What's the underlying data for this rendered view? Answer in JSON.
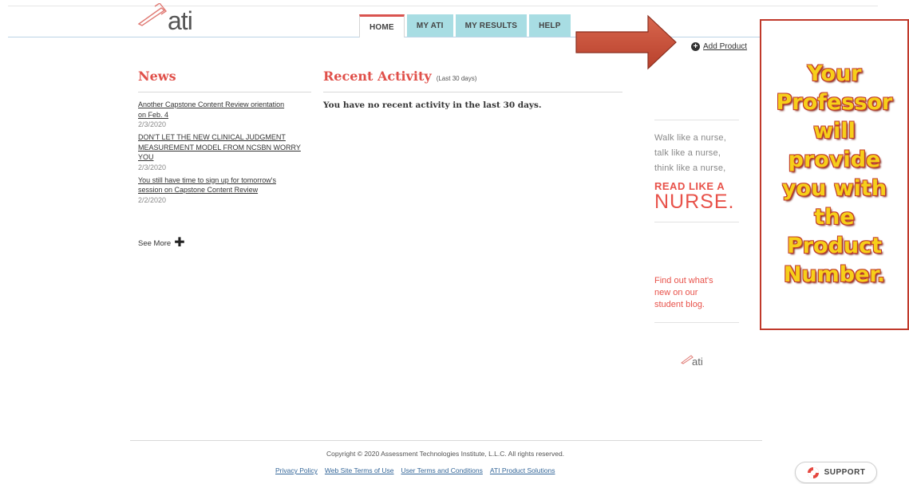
{
  "header": {
    "logo_text": "ati",
    "tabs": [
      {
        "label": "HOME",
        "active": true
      },
      {
        "label": "MY ATI",
        "active": false
      },
      {
        "label": "MY RESULTS",
        "active": false
      },
      {
        "label": "HELP",
        "active": false
      }
    ],
    "add_product_label": "Add Product"
  },
  "callout": {
    "text": "Your Professor will provide you with the Product Number.",
    "lines": [
      "Your",
      "Professor",
      "will",
      "provide",
      "you with",
      "the",
      "Product",
      "Number."
    ],
    "text_color": "#f6cf1a",
    "border_color": "#c0392b",
    "arrow_color": "#c9523c"
  },
  "news": {
    "title": "News",
    "items": [
      {
        "link": "Another Capstone Content Review orientation on Feb. 4",
        "link_lines": [
          "Another Capstone Content Review orientation",
          "on Feb. 4"
        ],
        "date": "2/3/2020"
      },
      {
        "link": "DON'T LET THE NEW CLINICAL JUDGMENT MEASUREMENT MODEL FROM NCSBN WORRY YOU",
        "link_lines": [
          "DON'T LET THE NEW CLINICAL JUDGMENT",
          "MEASUREMENT MODEL FROM NCSBN WORRY",
          "YOU"
        ],
        "date": "2/3/2020"
      },
      {
        "link": "You still have time to sign up for tomorrow's session on Capstone Content Review",
        "link_lines": [
          "You still have time to sign up for tomorrow's",
          "session on Capstone Content Review"
        ],
        "date": "2/2/2020"
      }
    ],
    "see_more_label": "See More"
  },
  "recent_activity": {
    "title": "Recent Activity",
    "subtitle": "(Last 30 days)",
    "message": "You have no recent activity in the last 30 days."
  },
  "sidebar": {
    "walk_lines": [
      "Walk like a nurse,",
      "talk like a nurse,",
      "think like a nurse,"
    ],
    "read_like_a": "READ LIKE A",
    "nurse": "NURSE.",
    "blog_lines": [
      "Find out what's",
      "new on our",
      "student blog."
    ],
    "small_logo_text": "ati"
  },
  "footer": {
    "copyright": "Copyright © 2020 Assessment Technologies Institute, L.L.C. All rights reserved.",
    "links": [
      "Privacy Policy",
      "Web Site Terms of Use",
      "User Terms and Conditions",
      "ATI Product Solutions"
    ],
    "support_label": "SUPPORT"
  },
  "colors": {
    "accent_red": "#e0504a",
    "tab_bg": "#a8dde3",
    "link_blue": "#336699"
  }
}
